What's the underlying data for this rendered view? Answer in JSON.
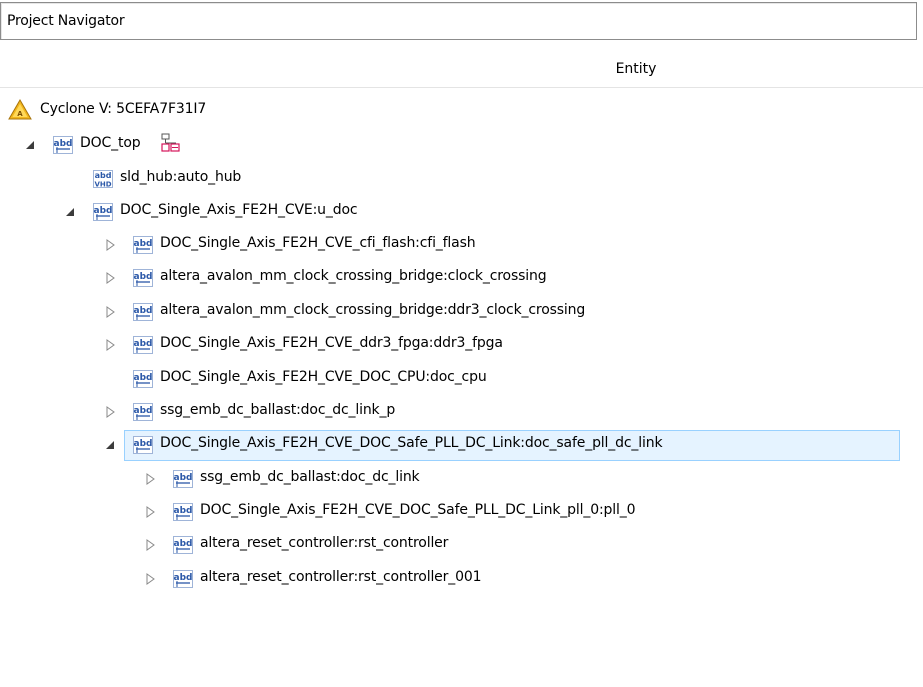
{
  "window": {
    "title": "Project Navigator"
  },
  "tree": {
    "column_header": "Entity",
    "device": {
      "label": "Cyclone V: 5CEFA7F31I7",
      "icon": "warning-icon"
    },
    "rows": [
      {
        "label": "DOC_top",
        "toggle": "expanded",
        "icon": "abd-icon"
      },
      {
        "label": "sld_hub:auto_hub",
        "toggle": "none",
        "icon": "abd-vhd-icon"
      },
      {
        "label": "DOC_Single_Axis_FE2H_CVE:u_doc",
        "toggle": "expanded",
        "icon": "abd-icon"
      },
      {
        "label": "DOC_Single_Axis_FE2H_CVE_cfi_flash:cfi_flash",
        "toggle": "collapsed",
        "icon": "abd-icon"
      },
      {
        "label": "altera_avalon_mm_clock_crossing_bridge:clock_crossing",
        "toggle": "collapsed",
        "icon": "abd-icon"
      },
      {
        "label": "altera_avalon_mm_clock_crossing_bridge:ddr3_clock_crossing",
        "toggle": "collapsed",
        "icon": "abd-icon"
      },
      {
        "label": "DOC_Single_Axis_FE2H_CVE_ddr3_fpga:ddr3_fpga",
        "toggle": "collapsed",
        "icon": "abd-icon"
      },
      {
        "label": "DOC_Single_Axis_FE2H_CVE_DOC_CPU:doc_cpu",
        "toggle": "none",
        "icon": "abd-icon"
      },
      {
        "label": "ssg_emb_dc_ballast:doc_dc_link_p",
        "toggle": "collapsed",
        "icon": "abd-icon"
      },
      {
        "label": "DOC_Single_Axis_FE2H_CVE_DOC_Safe_PLL_DC_Link:doc_safe_pll_dc_link",
        "toggle": "expanded",
        "icon": "abd-icon",
        "selected": true
      },
      {
        "label": "ssg_emb_dc_ballast:doc_dc_link",
        "toggle": "collapsed",
        "icon": "abd-icon"
      },
      {
        "label": "DOC_Single_Axis_FE2H_CVE_DOC_Safe_PLL_DC_Link_pll_0:pll_0",
        "toggle": "collapsed",
        "icon": "abd-icon"
      },
      {
        "label": "altera_reset_controller:rst_controller",
        "toggle": "collapsed",
        "icon": "abd-icon"
      },
      {
        "label": "altera_reset_controller:rst_controller_001",
        "toggle": "collapsed",
        "icon": "abd-icon"
      }
    ],
    "top_level_badge_icon": "hierarchy-icon"
  },
  "colors": {
    "selection_fill": "#e5f3ff",
    "selection_border": "#99d1ff",
    "icon_blue": "#2b58a8",
    "warning_fill": "#f2b61c",
    "hierarchy_red": "#d4145a"
  }
}
